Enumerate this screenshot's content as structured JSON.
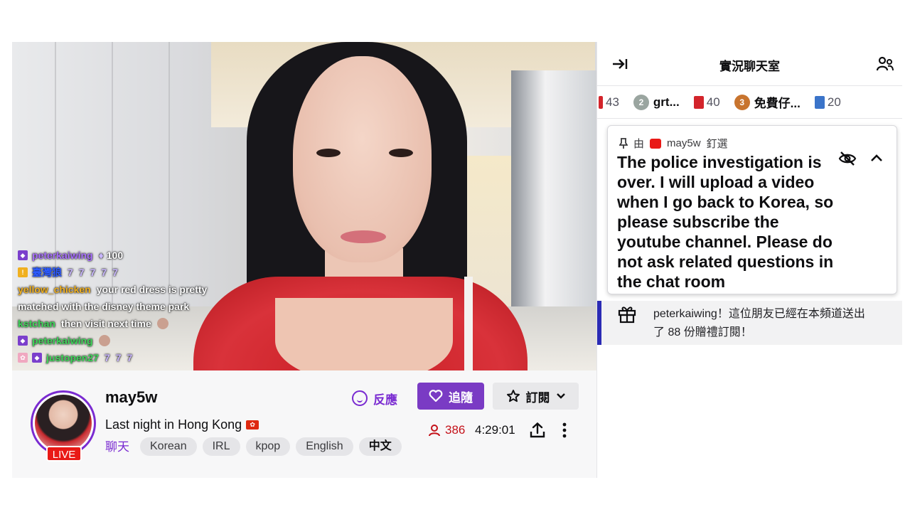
{
  "overlay_chat": [
    {
      "name": "peterkaiwing",
      "message": "100",
      "name_color": "purple",
      "kind": "bits"
    },
    {
      "name": "臺灣狼",
      "message": "77777",
      "name_color": "blue",
      "kind": "emote"
    },
    {
      "name": "yellow_chicken",
      "message": "your red dress is pretty",
      "name_color": "gold",
      "kind": "text"
    },
    {
      "name": "",
      "message": "matched with the disney theme park",
      "name_color": "gold",
      "kind": "continuation"
    },
    {
      "name": "kstchan",
      "message": "then visit next time",
      "name_color": "green",
      "kind": "text"
    },
    {
      "name": "peterkaiwing",
      "message": "",
      "name_color": "purple",
      "kind": "emote"
    },
    {
      "name": "justopen27",
      "message": "777",
      "name_color": "green",
      "kind": "emote"
    }
  ],
  "channel": {
    "name": "may5w",
    "live_label": "LIVE",
    "stream_title": "Last night in Hong Kong",
    "category": "聊天",
    "tags": [
      "Korean",
      "IRL",
      "kpop",
      "English",
      "中文"
    ]
  },
  "actions": {
    "react_label": "反應",
    "follow_label": "追隨",
    "subscribe_label": "訂閱"
  },
  "stats": {
    "viewers": "386",
    "uptime": "4:29:01"
  },
  "chat": {
    "title": "實況聊天室",
    "gift_bar": [
      {
        "label": "43",
        "icon": "gift-icon",
        "bold": false
      },
      {
        "label": "grt...",
        "icon": "rank-2-icon",
        "bold": true
      },
      {
        "label": "40",
        "icon": "gift-icon",
        "bold": false
      },
      {
        "label": "免費仔...",
        "icon": "rank-3-icon",
        "bold": true
      },
      {
        "label": "20",
        "icon": "gift-icon",
        "bold": false
      }
    ],
    "pinned": {
      "header_prefix": "由",
      "pinned_by": "may5w",
      "header_suffix": "釘選",
      "message": "The police investigation is over. I will upload a video when I go back to Korea, so please subscribe the youtube channel. Please do not ask related questions in the chat room"
    },
    "gift_notice": {
      "line1": "peterkaiwing！這位朋友已經在本頻道送出",
      "line2": "了 88 份贈禮訂閱！"
    }
  },
  "colors": {
    "brand_purple": "#7a3bc4",
    "live_red": "#e91916",
    "viewer_red": "#c4121a"
  }
}
